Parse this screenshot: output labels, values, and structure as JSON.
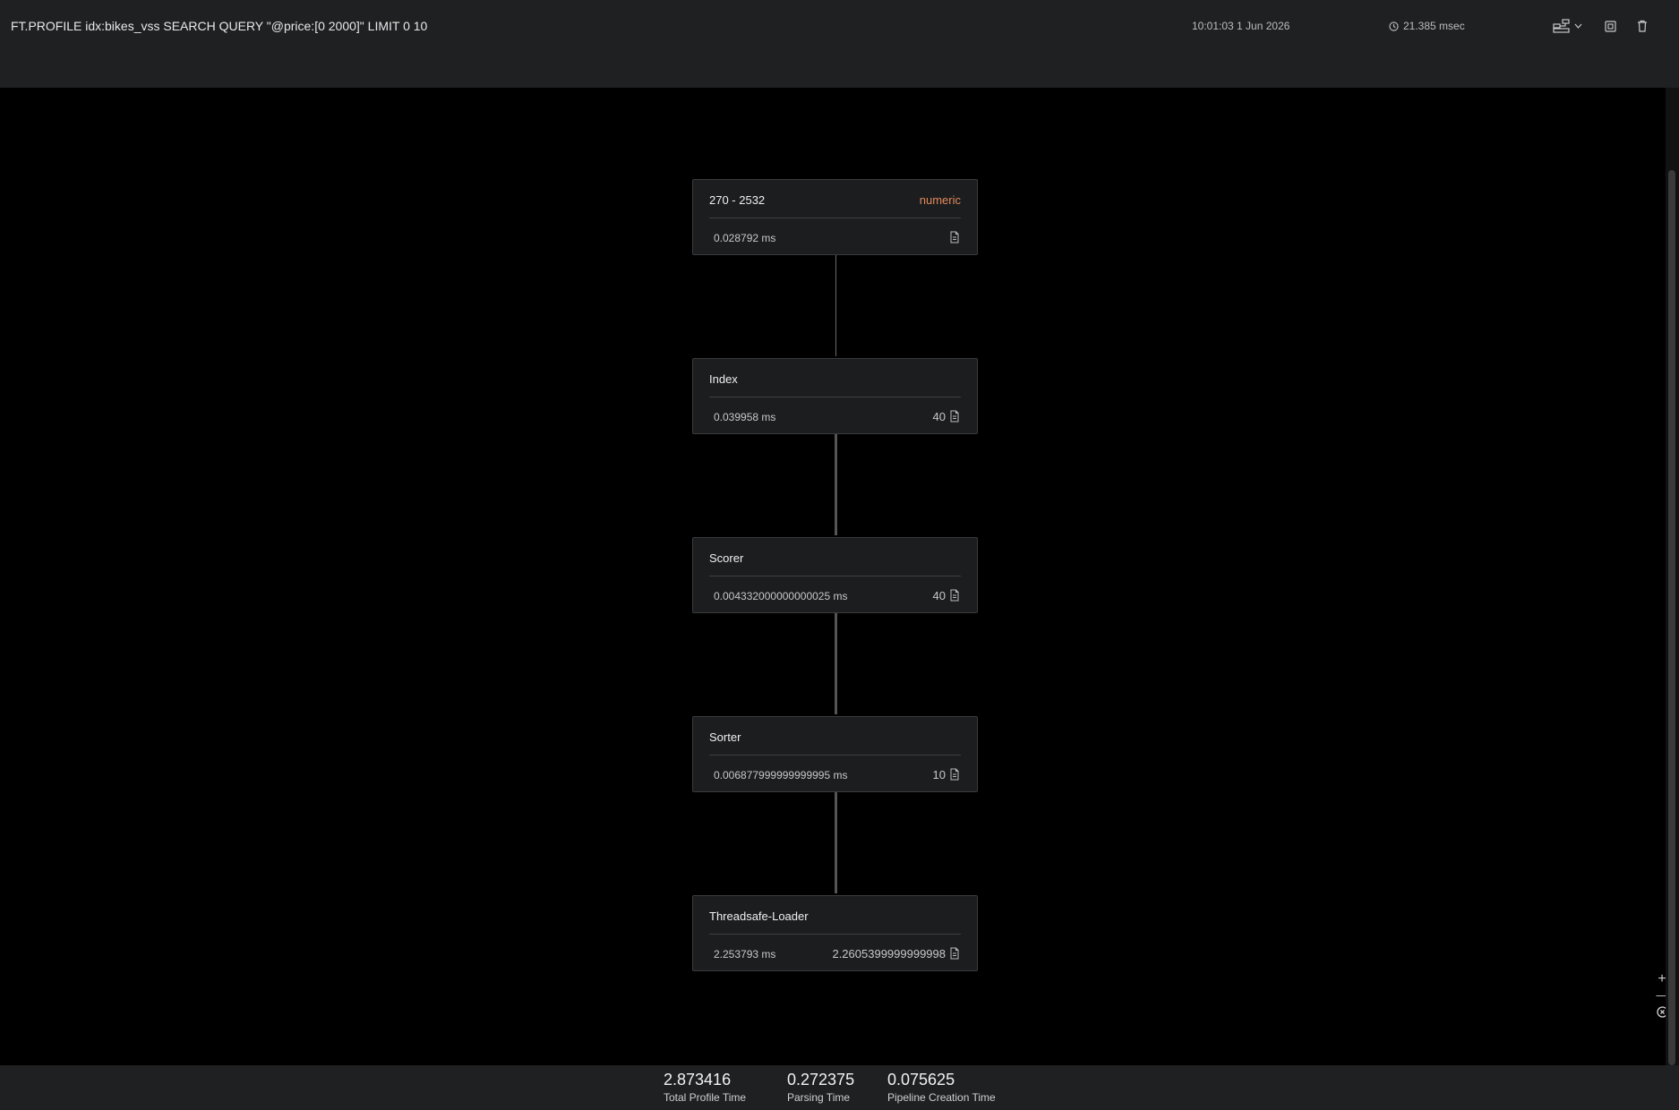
{
  "header": {
    "command": "FT.PROFILE idx:bikes_vss SEARCH QUERY \"@price:[0 2000]\" LIMIT 0 10",
    "timestamp": "10:01:03 1 Jun 2026",
    "duration": "21.385 msec",
    "icons": {
      "view": "tree-view-icon",
      "chevron": "chevron-down-icon",
      "copy": "copy-icon",
      "delete": "trash-icon",
      "clock": "clock-icon"
    }
  },
  "nodes": [
    {
      "title": "270 - 2532",
      "tag": "numeric",
      "time": "0.028792 ms",
      "count": ""
    },
    {
      "title": "Index",
      "tag": "",
      "time": "0.039958 ms",
      "count": "40"
    },
    {
      "title": "Scorer",
      "tag": "",
      "time": "0.004332000000000025 ms",
      "count": "40"
    },
    {
      "title": "Sorter",
      "tag": "",
      "time": "0.006877999999999995 ms",
      "count": "10"
    },
    {
      "title": "Threadsafe-Loader",
      "tag": "",
      "time": "2.253793 ms",
      "count": "2.2605399999999998"
    }
  ],
  "zoom": {
    "in_label": "+",
    "out_label": "—",
    "reset_icon": "reset-zoom-icon"
  },
  "footer": {
    "stats": [
      {
        "value": "2.873416",
        "label": "Total Profile Time"
      },
      {
        "value": "0.272375",
        "label": "Parsing Time"
      },
      {
        "value": "0.075625",
        "label": "Pipeline Creation Time"
      }
    ]
  },
  "colors": {
    "accent_tag": "#e0895a",
    "panel": "#1f2021",
    "node": "#1c1d1f"
  }
}
